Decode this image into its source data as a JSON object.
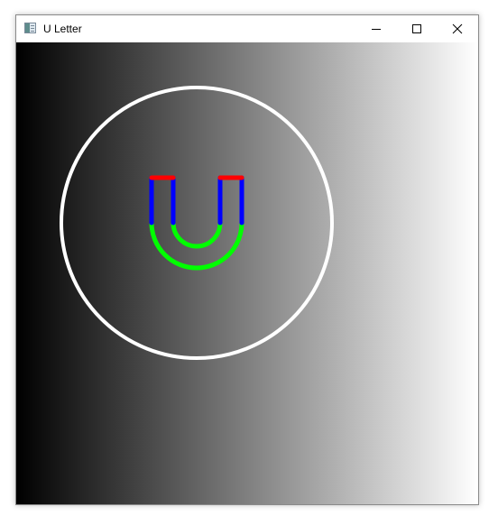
{
  "window": {
    "title": "U Letter",
    "icon": "app-window-icon",
    "controls": {
      "minimize_icon": "minimize-icon",
      "maximize_icon": "maximize-icon",
      "close_icon": "close-icon"
    }
  },
  "canvas": {
    "background_gradient": [
      "#000000",
      "#ffffff"
    ],
    "circle_color": "#ffffff",
    "letter": {
      "tip_color": "#ff0000",
      "stem_color": "#0000ff",
      "curve_color": "#00ff00"
    }
  }
}
